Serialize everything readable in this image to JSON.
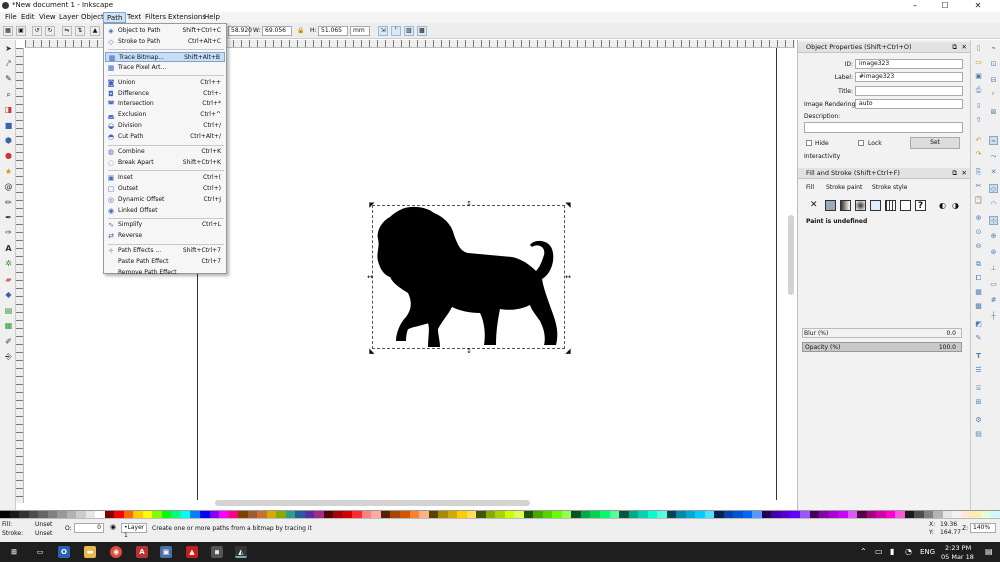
{
  "window": {
    "title": "*New document 1 - Inkscape",
    "minimize": "–",
    "maximize": "☐",
    "close": "✕"
  },
  "menubar": {
    "items": [
      "File",
      "Edit",
      "View",
      "Layer",
      "Object",
      "Path",
      "Text",
      "Filters",
      "Extensions",
      "Help"
    ],
    "active": "Path"
  },
  "toolbar": {
    "x_value": "58.920",
    "w_label": "W:",
    "w_value": "69.056",
    "lock": "🔒",
    "h_label": "H:",
    "h_value": "51.065",
    "unit": "mm"
  },
  "path_menu": [
    {
      "label": "Object to Path",
      "shortcut": "Shift+Ctrl+C",
      "icon": "object-to-path-icon"
    },
    {
      "label": "Stroke to Path",
      "shortcut": "Ctrl+Alt+C",
      "icon": "stroke-to-path-icon"
    },
    {
      "label": "Trace Bitmap...",
      "shortcut": "Shift+Alt+B",
      "icon": "trace-bitmap-icon",
      "highlighted": true
    },
    {
      "label": "Trace Pixel Art...",
      "shortcut": "",
      "icon": "trace-pixel-art-icon"
    },
    {
      "label": "Union",
      "shortcut": "Ctrl++",
      "icon": "union-icon"
    },
    {
      "label": "Difference",
      "shortcut": "Ctrl+-",
      "icon": "difference-icon"
    },
    {
      "label": "Intersection",
      "shortcut": "Ctrl+*",
      "icon": "intersection-icon"
    },
    {
      "label": "Exclusion",
      "shortcut": "Ctrl+^",
      "icon": "exclusion-icon"
    },
    {
      "label": "Division",
      "shortcut": "Ctrl+/",
      "icon": "division-icon"
    },
    {
      "label": "Cut Path",
      "shortcut": "Ctrl+Alt+/",
      "icon": "cut-path-icon"
    },
    {
      "label": "Combine",
      "shortcut": "Ctrl+K",
      "icon": "combine-icon"
    },
    {
      "label": "Break Apart",
      "shortcut": "Shift+Ctrl+K",
      "icon": "break-apart-icon"
    },
    {
      "label": "Inset",
      "shortcut": "Ctrl+(",
      "icon": "inset-icon"
    },
    {
      "label": "Outset",
      "shortcut": "Ctrl+)",
      "icon": "outset-icon"
    },
    {
      "label": "Dynamic Offset",
      "shortcut": "Ctrl+J",
      "icon": "dynamic-offset-icon"
    },
    {
      "label": "Linked Offset",
      "shortcut": "",
      "icon": "linked-offset-icon"
    },
    {
      "label": "Simplify",
      "shortcut": "Ctrl+L",
      "icon": "simplify-icon"
    },
    {
      "label": "Reverse",
      "shortcut": "",
      "icon": "reverse-icon"
    },
    {
      "label": "Path Effects ...",
      "shortcut": "Shift+Ctrl+7",
      "icon": "path-effects-icon"
    },
    {
      "label": "Paste Path Effect",
      "shortcut": "Ctrl+7",
      "icon": ""
    },
    {
      "label": "Remove Path Effect",
      "shortcut": "",
      "icon": ""
    }
  ],
  "object_properties": {
    "header": "Object Properties (Shift+Ctrl+O)",
    "id_label": "ID:",
    "id_value": "image323",
    "label_label": "Label:",
    "label_value": "#image323",
    "title_label": "Title:",
    "title_value": "",
    "rendering_label": "Image Rendering:",
    "rendering_value": "auto",
    "description_label": "Description:",
    "hide_label": "Hide",
    "lock_label": "Lock",
    "set_button": "Set",
    "interactivity_label": "Interactivity"
  },
  "fill_stroke": {
    "header": "Fill and Stroke (Shift+Ctrl+F)",
    "tabs": [
      "Fill",
      "Stroke paint",
      "Stroke style"
    ],
    "paint_status": "Paint is undefined",
    "blur_label": "Blur (%)",
    "blur_value": "0.0",
    "opacity_label": "Opacity (%)",
    "opacity_value": "100.0"
  },
  "status": {
    "fill_label": "Fill:",
    "fill_value": "Unset",
    "stroke_label": "Stroke:",
    "stroke_value": "Unset",
    "opacity_label": "O:",
    "opacity_value": "0",
    "layer": "•Layer 1",
    "message": "Create one or more paths from a bitmap by tracing it",
    "x_label": "X:",
    "x_value": "19.36",
    "y_label": "Y:",
    "y_value": "164.77",
    "z_label": "Z:",
    "zoom": "140%"
  },
  "taskbar": {
    "lang": "ENG",
    "time": "2:23 PM",
    "date": "05 Mar 18"
  },
  "palette_colors": [
    "#000000",
    "#1a1a1a",
    "#333333",
    "#4d4d4d",
    "#666666",
    "#808080",
    "#999999",
    "#b3b3b3",
    "#cccccc",
    "#e6e6e6",
    "#ffffff",
    "#800000",
    "#ff0000",
    "#ff6600",
    "#ffcc00",
    "#ffff00",
    "#80ff00",
    "#00ff00",
    "#00ff80",
    "#00ffff",
    "#0080ff",
    "#0000ff",
    "#8000ff",
    "#ff00ff",
    "#ff0080",
    "#804000",
    "#a05a2c",
    "#c87137",
    "#d4aa00",
    "#88aa00",
    "#2ca089",
    "#2c5aa0",
    "#5a2ca0",
    "#a02c89",
    "#550000",
    "#aa0000",
    "#d40000",
    "#ff2a2a",
    "#ff8080",
    "#ffaaaa",
    "#552200",
    "#aa4400",
    "#d45500",
    "#ff7f2a",
    "#ffb380",
    "#554400",
    "#aa8800",
    "#d4aa00",
    "#ffcc00",
    "#ffdd55",
    "#445500",
    "#88aa00",
    "#aad400",
    "#ccff00",
    "#ddff55",
    "#225500",
    "#44aa00",
    "#55d400",
    "#66ff00",
    "#99ff55",
    "#005522",
    "#00aa44",
    "#00d455",
    "#00ff66",
    "#55ff99",
    "#005544",
    "#00aa88",
    "#00d4aa",
    "#00ffcc",
    "#55ffdd",
    "#004455",
    "#0088aa",
    "#00aad4",
    "#00ccff",
    "#55ddff",
    "#002255",
    "#0044aa",
    "#0055d4",
    "#0066ff",
    "#5599ff",
    "#220055",
    "#4400aa",
    "#5500d4",
    "#6600ff",
    "#9955ff",
    "#440055",
    "#8800aa",
    "#aa00d4",
    "#cc00ff",
    "#dd55ff",
    "#550044",
    "#aa0088",
    "#d400aa",
    "#ff00cc",
    "#ff55dd",
    "#1a1a1a",
    "#4d4d4d",
    "#808080",
    "#b3b3b3",
    "#e6e6e6",
    "#f2f2f2",
    "#ffe6d5",
    "#ffeeaa",
    "#e5ffd5",
    "#d5f6ff"
  ]
}
